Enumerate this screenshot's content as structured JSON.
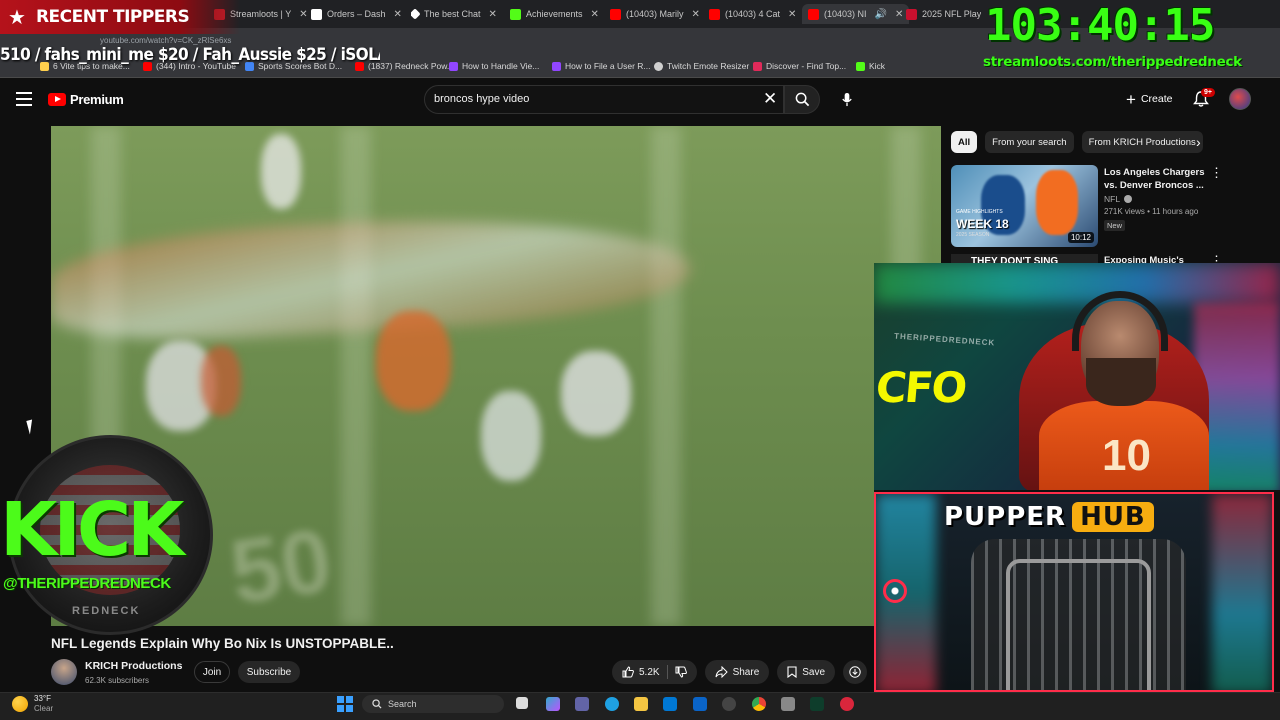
{
  "browser": {
    "tabs": [
      {
        "label": "Streamloots | Y",
        "color": "#c11f2b"
      },
      {
        "label": "Orders – Dash",
        "color": "#ffffff"
      },
      {
        "label": "The best Chat",
        "color": "#ffffff"
      },
      {
        "label": "Achievements",
        "color": "#53fc18"
      },
      {
        "label": "(10403) Marily",
        "color": "#ff0000"
      },
      {
        "label": "(10403) 4 Cat",
        "color": "#ff0000"
      },
      {
        "label": "(10403) NI",
        "color": "#ff0000"
      },
      {
        "label": "2025 NFL Play",
        "color": "#c8102e"
      }
    ],
    "url": "youtube.com/watch?v=CK_zRlSe6xs",
    "bookmarks": [
      {
        "label": "6 Vite tips to make...",
        "color": "#ffcf4d"
      },
      {
        "label": "(344) Intro - YouTube",
        "color": "#ff0000"
      },
      {
        "label": "Sports Scores Bot D...",
        "color": "#4285f4"
      },
      {
        "label": "(1837) Redneck Pow...",
        "color": "#ff0000"
      },
      {
        "label": "How to Handle Vie...",
        "color": "#9146ff"
      },
      {
        "label": "How to File a User R...",
        "color": "#9146ff"
      },
      {
        "label": "Twitch Emote Resizer",
        "color": "#cfcfcf"
      },
      {
        "label": "Discover - Find Top...",
        "color": "#e02a5a"
      },
      {
        "label": "Kick",
        "color": "#53fc18"
      }
    ]
  },
  "overlay": {
    "tippers_label": "RECENT TIPPERS",
    "ticker": "510 / fahs_mini_me $20 / Fah_Aussie $25 / iSOLA",
    "timer": "103:40:15",
    "stream_url": "streamloots.com/therippedredneck",
    "kick_word": "KICK",
    "kick_handle": "@THERIPPEDREDNECK",
    "kick_sub": "REDNECK",
    "pupper_word1": "PUPPER",
    "pupper_word2": "HUB",
    "webcam_text": "CFO",
    "webcam_watermark": "THERIPPEDREDNECK",
    "webcam_jersey": "10"
  },
  "youtube": {
    "brand": "Premium",
    "search_value": "broncos hype video",
    "create_label": "Create",
    "bell_badge": "9+",
    "video": {
      "title": "NFL Legends Explain Why Bo Nix Is UNSTOPPABLE..",
      "yard_number": "50",
      "channel": "KRICH Productions",
      "subscribers": "62.3K subscribers",
      "join_label": "Join",
      "subscribe_label": "Subscribe",
      "likes": "5.2K",
      "share_label": "Share",
      "save_label": "Save"
    },
    "chips": [
      "All",
      "From your search",
      "From KRICH Productions"
    ],
    "recommendations": [
      {
        "title": "Los Angeles Chargers vs. Denver Broncos ...",
        "channel": "NFL",
        "meta": "271K views • 11 hours ago",
        "badge": "New",
        "duration": "10:12",
        "thumb_text": "WEEK 18",
        "thumb_small": "GAME HIGHLIGHTS",
        "thumb_season": "2025 SEASON"
      },
      {
        "title": "Exposing Music's",
        "thumb_text": "THEY DON'T SING"
      }
    ]
  },
  "taskbar": {
    "temp": "33°F",
    "condition": "Clear",
    "search_label": "Search"
  }
}
